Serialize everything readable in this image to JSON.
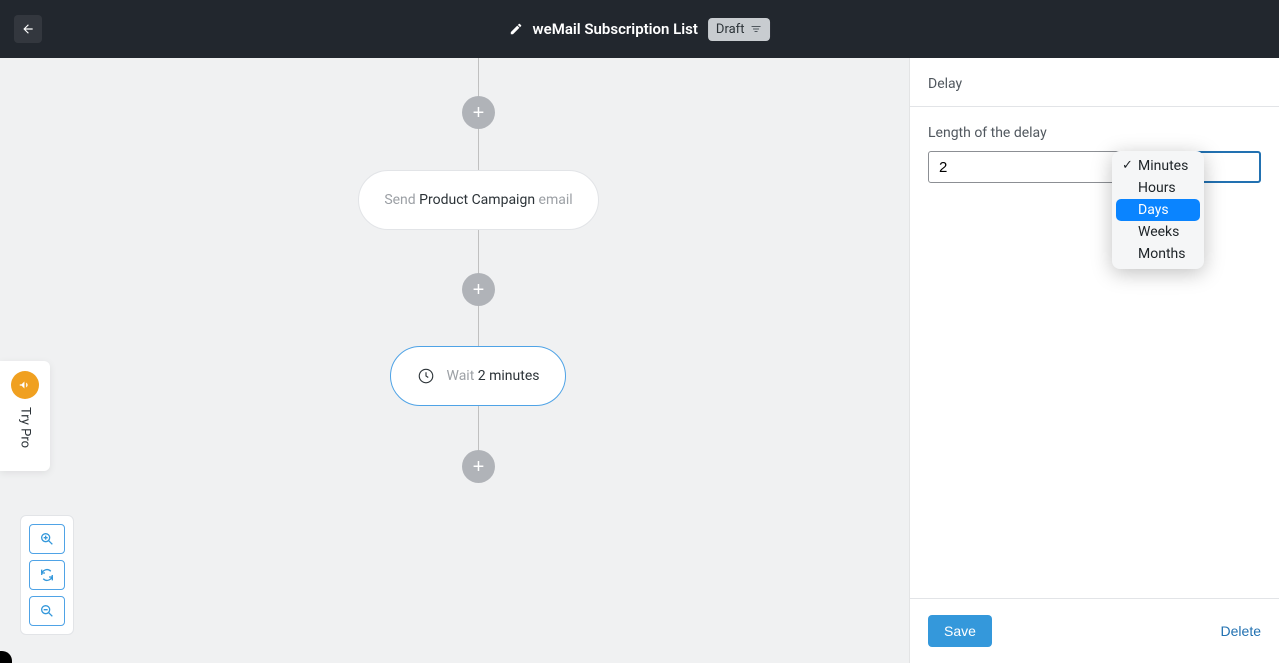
{
  "header": {
    "title": "weMail Subscription List",
    "badge": "Draft"
  },
  "flow": {
    "send": {
      "prefix": "Send ",
      "campaign": "Product Campaign",
      "suffix": " email"
    },
    "wait": {
      "prefix": "Wait ",
      "duration": "2 minutes"
    }
  },
  "tryPro": {
    "label": "Try Pro"
  },
  "panel": {
    "title": "Delay",
    "field_label": "Length of the delay",
    "delay_value": "2",
    "save_label": "Save",
    "delete_label": "Delete"
  },
  "dropdown": {
    "options": [
      "Minutes",
      "Hours",
      "Days",
      "Weeks",
      "Months"
    ],
    "selected": "Minutes",
    "highlighted": "Days"
  }
}
